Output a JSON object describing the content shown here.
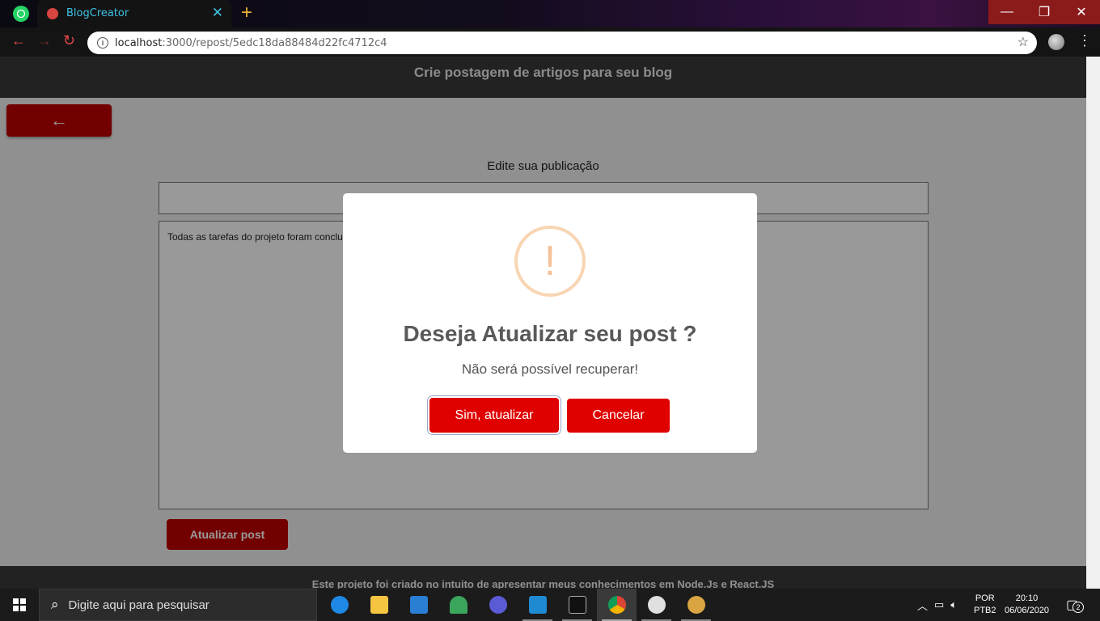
{
  "browser": {
    "tab_title": "BlogCreator",
    "url_host": "localhost",
    "url_path": ":3000/repost/5edc18da88484d22fc4712c4"
  },
  "site": {
    "subtitle": "Crie postagem de artigos para seu blog",
    "form_title": "Edite sua publicação",
    "title_value": "",
    "content_value": "Todas as tarefas do projeto foram conclu",
    "update_button": "Atualizar post",
    "footer": "Este projeto foi criado no intuito de apresentar meus conhecimentos em Node.Js e React.JS"
  },
  "modal": {
    "title": "Deseja Atualizar seu post ?",
    "text": "Não será possível recuperar!",
    "confirm_label": "Sim, atualizar",
    "cancel_label": "Cancelar",
    "icon": "warning-icon"
  },
  "taskbar": {
    "search_placeholder": "Digite aqui para pesquisar",
    "lang_line1": "POR",
    "lang_line2": "PTB2",
    "time": "20:10",
    "date": "06/06/2020",
    "notification_count": "2"
  },
  "colors": {
    "accent_red": "#e00000",
    "header_dark": "#3a3a3a",
    "warning_ring": "#f8d5b3"
  }
}
